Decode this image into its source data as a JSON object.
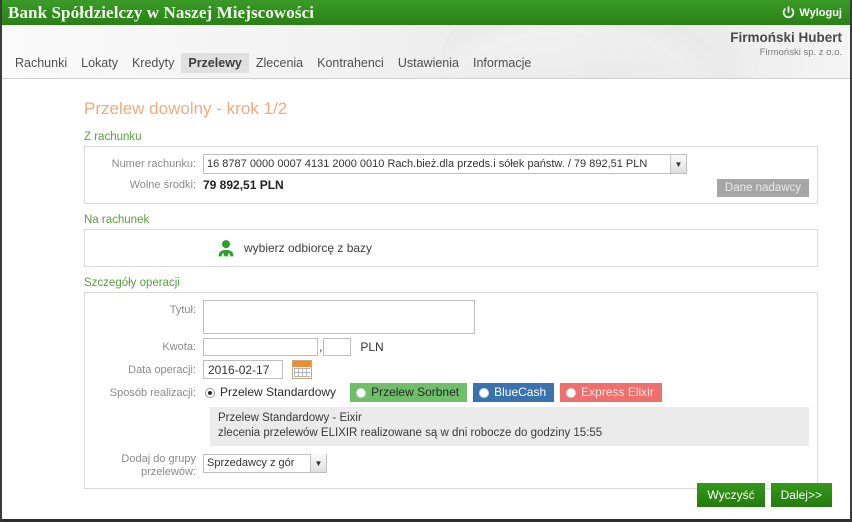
{
  "topbar": {
    "bank_name": "Bank Spółdzielczy w Naszej Miejscowości",
    "logout_label": "Wyloguj",
    "logout_icon": "power-icon",
    "bar_color": "#2d8b1e"
  },
  "header": {
    "user_name": "Firmoński Hubert",
    "user_company": "Firmoński sp. z o.o."
  },
  "nav": {
    "items": [
      {
        "label": "Rachunki",
        "active": false
      },
      {
        "label": "Lokaty",
        "active": false
      },
      {
        "label": "Kredyty",
        "active": false
      },
      {
        "label": "Przelewy",
        "active": true
      },
      {
        "label": "Zlecenia",
        "active": false
      },
      {
        "label": "Kontrahenci",
        "active": false
      },
      {
        "label": "Ustawienia",
        "active": false
      },
      {
        "label": "Informacje",
        "active": false
      }
    ]
  },
  "page": {
    "title": "Przelew dowolny - krok 1/2",
    "title_color": "#f0ab7c"
  },
  "from_account": {
    "section_label": "Z rachunku",
    "account_number_label": "Numer rachunku:",
    "account_number_value": "16 8787 0000 0007 4131 2000 0010 Rach.bież.dla przeds.i sółek państw. / 79 892,51 PLN",
    "free_funds_label": "Wolne środki:",
    "free_funds_value": "79 892,51 PLN",
    "sender_data_button": "Dane nadawcy"
  },
  "to_account": {
    "section_label": "Na rachunek",
    "pick_recipient_label": "wybierz odbiorcę z bazy",
    "recipient_icon": "person-icon"
  },
  "details": {
    "section_label": "Szczegóły operacji",
    "title_label": "Tytuł:",
    "title_value": "",
    "amount_label": "Kwota:",
    "amount_integer": "",
    "amount_separator": ",",
    "amount_decimal": "",
    "currency": "PLN",
    "date_label": "Data operacji:",
    "date_value": "2016-02-17",
    "calendar_icon": "calendar-icon",
    "method_label": "Sposób realizacji:",
    "methods": [
      {
        "label": "Przelew Standardowy",
        "selected": true,
        "style": "plain"
      },
      {
        "label": "Przelew Sorbnet",
        "selected": false,
        "style": "green"
      },
      {
        "label": "BlueCash",
        "selected": false,
        "style": "blue"
      },
      {
        "label": "Express Elixir",
        "selected": false,
        "style": "red"
      }
    ],
    "method_desc_line1": "Przelew Standardowy - Eixir",
    "method_desc_line2": "zlecenia przelewów ELIXIR realizowane są w dni robocze do godziny 15:55",
    "group_label_line1": "Dodaj do grupy",
    "group_label_line2": "przelewów:",
    "group_value": "Sprzedawcy z gór"
  },
  "footer": {
    "clear_button": "Wyczyść",
    "next_button": "Dalej>>",
    "button_color": "#2b8a12"
  }
}
